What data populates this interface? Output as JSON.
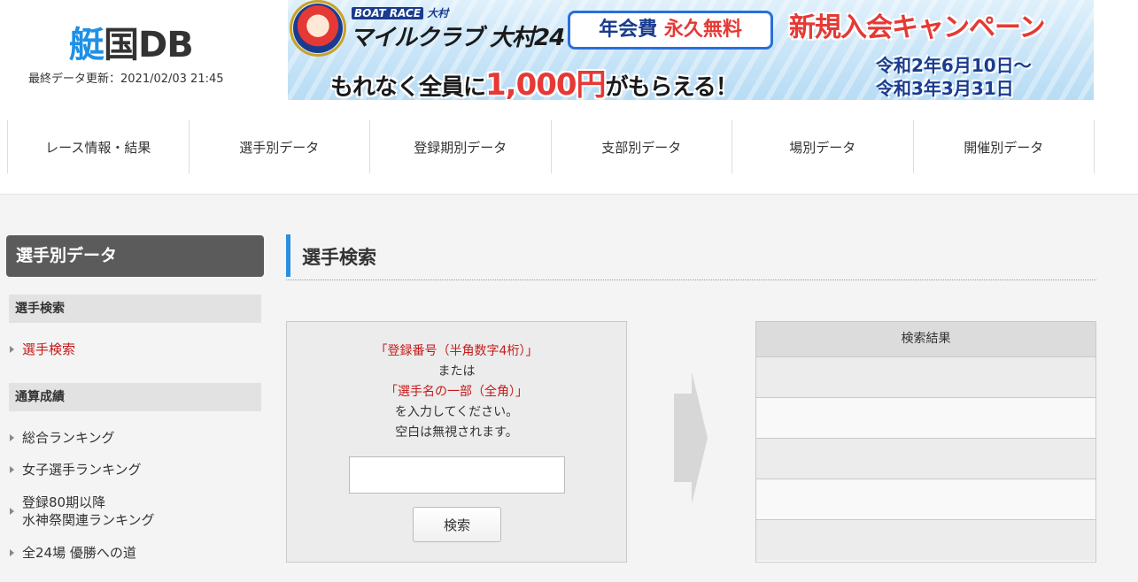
{
  "header": {
    "logo_part1": "艇",
    "logo_part2": "国DB",
    "updated": "最終データ更新：2021/02/03 21:45"
  },
  "banner": {
    "brand": "BOAT RACE",
    "brand_venue": "大村",
    "club": "マイルクラブ 大村24",
    "fee_label": "年会費",
    "fee_value": "永久無料",
    "campaign": "新規入会キャンペーン",
    "gift_prefix": "もれなく全員に",
    "gift_amount": "1,000円",
    "gift_suffix": "がもらえる！",
    "date_start": "令和2年6月10日〜",
    "date_end": "令和3年3月31日"
  },
  "nav": {
    "items": [
      {
        "label": "レース情報・結果"
      },
      {
        "label": "選手別データ"
      },
      {
        "label": "登録期別データ"
      },
      {
        "label": "支部別データ"
      },
      {
        "label": "場別データ"
      },
      {
        "label": "開催別データ"
      }
    ]
  },
  "sidebar": {
    "title": "選手別データ",
    "section1": "選手検索",
    "link_search": "選手検索",
    "section2": "通算成績",
    "link_overall": "総合ランキング",
    "link_women": "女子選手ランキング",
    "link_reg80_line1": "登録80期以降",
    "link_reg80_line2": "水神祭関連ランキング",
    "link_all24": "全24場 優勝への道"
  },
  "main": {
    "title": "選手検索",
    "instr_red1": "「登録番号（半角数字4桁）」",
    "instr_or": "または",
    "instr_red2": "「選手名の一部（全角）」",
    "instr_enter": "を入力してください。",
    "instr_space": "空白は無視されます。",
    "search_input_value": "",
    "search_button": "検索",
    "results_header": "検索結果"
  },
  "colors": {
    "accent": "#2b8fe0",
    "logo_blue": "#1e90e6",
    "active_link": "#c41a1a"
  }
}
